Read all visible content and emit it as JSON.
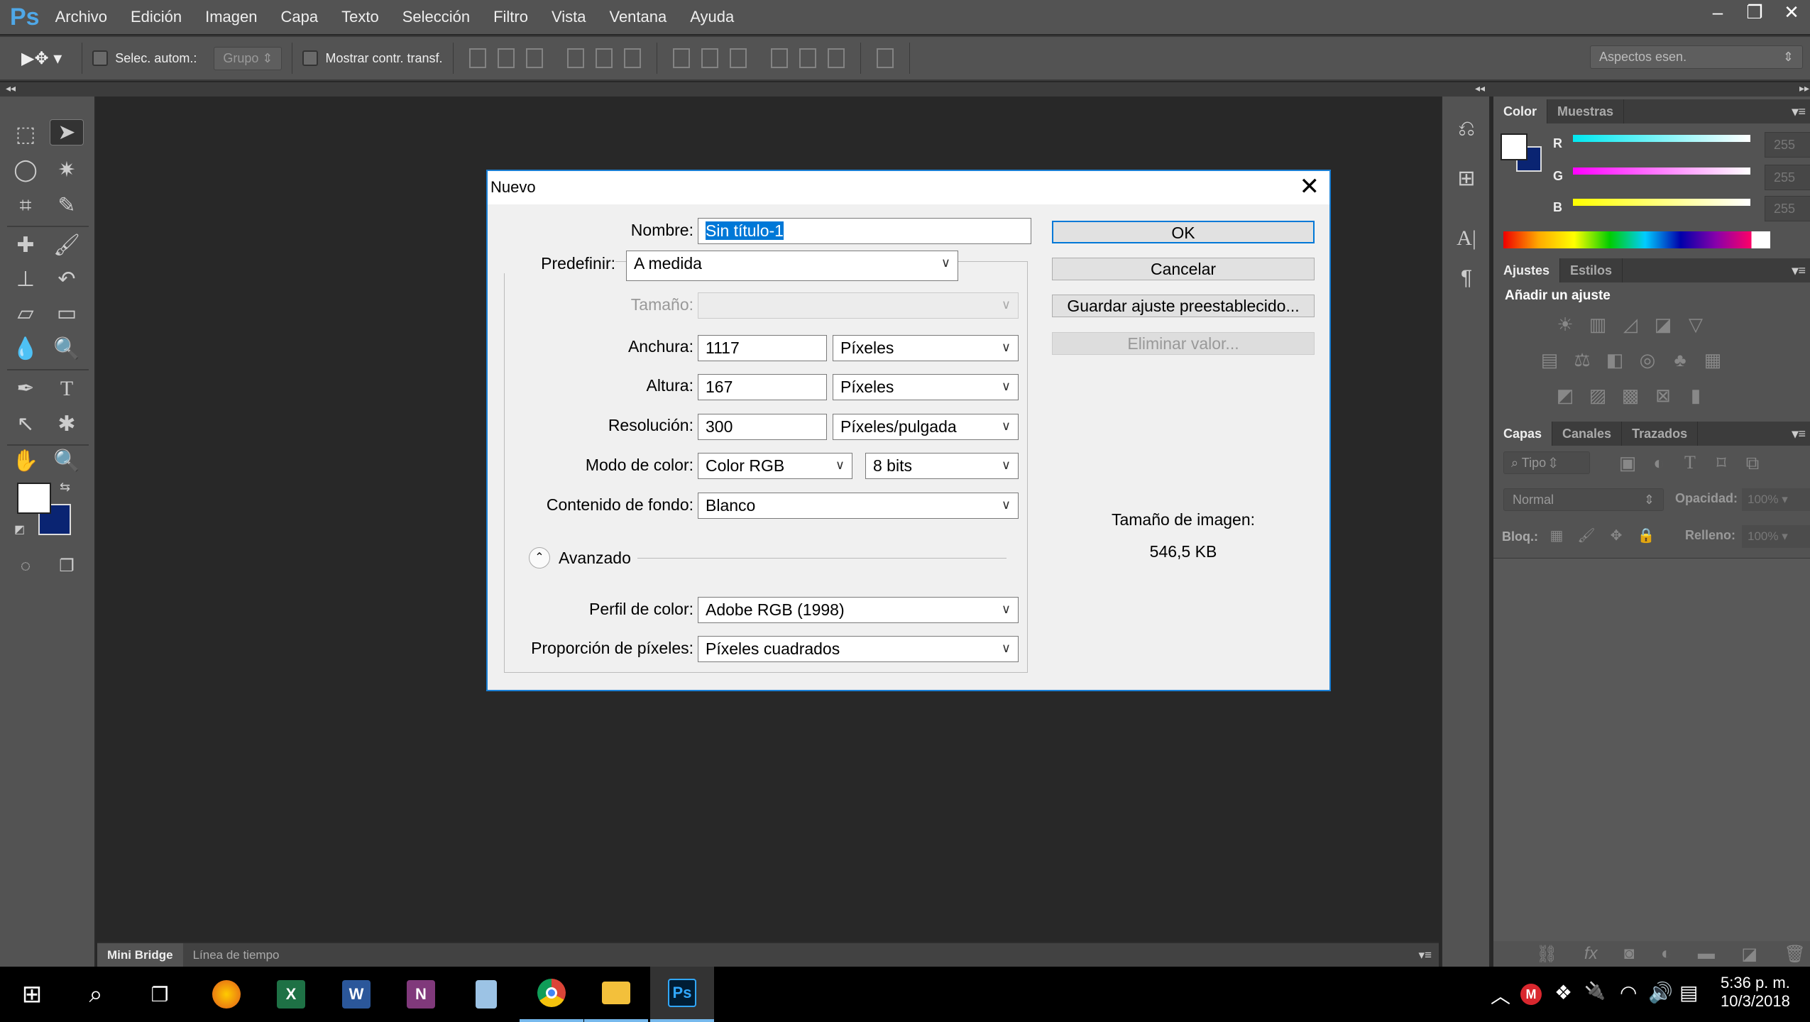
{
  "app": {
    "logo": "Ps",
    "menu": [
      "Archivo",
      "Edición",
      "Imagen",
      "Capa",
      "Texto",
      "Selección",
      "Filtro",
      "Vista",
      "Ventana",
      "Ayuda"
    ],
    "window_controls": [
      "minimize",
      "restore",
      "close"
    ]
  },
  "options": {
    "auto_select_label": "Selec. autom.:",
    "auto_select_value": "Grupo",
    "show_transform_label": "Mostrar contr. transf.",
    "workspace": "Aspectos esen."
  },
  "tools": [
    "rectangular-marquee",
    "move",
    "lasso",
    "magic-wand",
    "crop",
    "eyedropper",
    "healing-brush",
    "brush",
    "clone-stamp",
    "history-brush",
    "eraser",
    "gradient",
    "blur",
    "dodge",
    "pen",
    "type",
    "path-selection",
    "custom-shape",
    "hand",
    "zoom"
  ],
  "colors": {
    "foreground": "#ffffff",
    "background": "#0a2472",
    "accent": "#1a7fd4"
  },
  "bottom_tabs": [
    "Mini Bridge",
    "Línea de tiempo"
  ],
  "color_panel": {
    "tabs": [
      "Color",
      "Muestras"
    ],
    "channels": [
      {
        "label": "R",
        "value": "255"
      },
      {
        "label": "G",
        "value": "255"
      },
      {
        "label": "B",
        "value": "255"
      }
    ]
  },
  "adjust_panel": {
    "tabs": [
      "Ajustes",
      "Estilos"
    ],
    "heading": "Añadir un ajuste"
  },
  "layers_panel": {
    "tabs": [
      "Capas",
      "Canales",
      "Trazados"
    ],
    "filter": "Tipo",
    "blend": "Normal",
    "opacity_label": "Opacidad:",
    "opacity": "100%",
    "lock_label": "Bloq.:",
    "fill_label": "Relleno:",
    "fill": "100%"
  },
  "dialog": {
    "title": "Nuevo",
    "name_label": "Nombre:",
    "name_value": "Sin título-1",
    "preset_label": "Predefinir:",
    "preset_value": "A medida",
    "size_label": "Tamaño:",
    "width_label": "Anchura:",
    "width_value": "1117",
    "width_unit": "Píxeles",
    "height_label": "Altura:",
    "height_value": "167",
    "height_unit": "Píxeles",
    "res_label": "Resolución:",
    "res_value": "300",
    "res_unit": "Píxeles/pulgada",
    "mode_label": "Modo de color:",
    "mode_value": "Color RGB",
    "bits_value": "8 bits",
    "bg_label": "Contenido de fondo:",
    "bg_value": "Blanco",
    "advanced_label": "Avanzado",
    "profile_label": "Perfil de color:",
    "profile_value": "Adobe RGB (1998)",
    "aspect_label": "Proporción de píxeles:",
    "aspect_value": "Píxeles cuadrados",
    "ok": "OK",
    "cancel": "Cancelar",
    "save_preset": "Guardar ajuste preestablecido...",
    "delete_preset": "Eliminar valor...",
    "image_size_label": "Tamaño de imagen:",
    "image_size_value": "546,5 KB"
  },
  "taskbar": {
    "apps": [
      "Firefox",
      "Excel",
      "Word",
      "OneNote",
      "Calculadora",
      "Chrome",
      "Explorador de archivos",
      "Photoshop"
    ],
    "time": "5:36 p. m.",
    "date": "10/3/2018"
  }
}
